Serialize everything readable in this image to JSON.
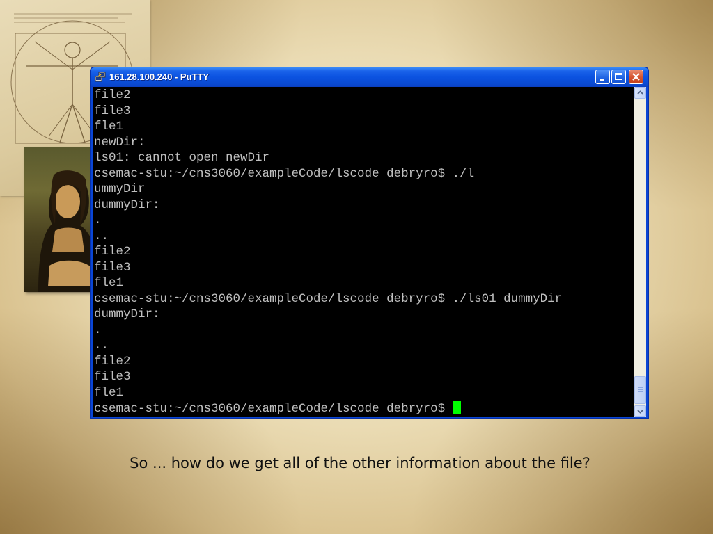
{
  "window": {
    "title": "161.28.100.240 - PuTTY",
    "buttons": {
      "minimize": "minimize",
      "maximize": "maximize",
      "close": "close"
    }
  },
  "terminal": {
    "lines": [
      "file2",
      "file3",
      "fle1",
      "newDir:",
      "ls01: cannot open newDir",
      "csemac-stu:~/cns3060/exampleCode/lscode debryro$ ./l",
      "ummyDir",
      "dummyDir:",
      ".",
      "..",
      "file2",
      "file3",
      "fle1",
      "csemac-stu:~/cns3060/exampleCode/lscode debryro$ ./ls01 dummyDir",
      "dummyDir:",
      ".",
      "..",
      "file2",
      "file3",
      "fle1",
      "csemac-stu:~/cns3060/exampleCode/lscode debryro$ "
    ],
    "cursor_color": "#00ff00",
    "text_color": "#c0c0c0"
  },
  "slide": {
    "caption": "So ... how do we get all of the other information about the file?"
  },
  "icons": {
    "app": "putty-icon",
    "scroll_up": "chevron-up-icon",
    "scroll_down": "chevron-down-icon"
  }
}
